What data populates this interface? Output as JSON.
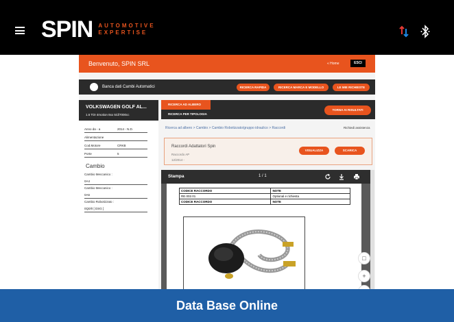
{
  "topbar": {
    "logo_main": "SPIN",
    "logo_sub_1": "AUTOMOTIVE",
    "logo_sub_2": "EXPERTISE",
    "icons": [
      "menu-icon",
      "sort-arrows-icon",
      "bluetooth-icon"
    ],
    "colors": {
      "background": "#000000",
      "logo_accent": "#e8541e",
      "sort_up": "#e53935",
      "sort_down": "#1e88e5"
    }
  },
  "app": {
    "welcome": "Benvenuto, SPIN SRL",
    "home": "« Home",
    "exit": "ESCI",
    "nav_title": "Banca dati Cambi Automatici",
    "nav_buttons": [
      "RICERCA RAPIDA",
      "RICERCA MARCA E MODELLO",
      "LE MIE RICHIESTE"
    ],
    "vehicle": {
      "name": "VOLKSWAGEN GOLF AL...",
      "engine": "1.6 TDI 4motion 8xx 5/d/7000cc"
    },
    "specs": [
      {
        "label": "Anno da - a",
        "value": "2014 - N.D."
      },
      {
        "label": "Alimentazione",
        "value": ""
      },
      {
        "label": "Cod.Motore",
        "value": "CRKB"
      },
      {
        "label": "Porte",
        "value": "5"
      }
    ],
    "gearbox_heading": "Cambio",
    "gearbox": [
      {
        "label": "Cambio Meccanico :",
        "value": "0A4"
      },
      {
        "label": "Cambio Meccanico :",
        "value": "0A6"
      },
      {
        "label": "Cambio Robotizzato :",
        "value": "0Q0/0 [ DSG ]"
      }
    ],
    "tabs": [
      "RICERCA AD ALBERO",
      "RICERCA PER TIPOLOGIA"
    ],
    "back_button": "TORNA AI RISULTATI",
    "breadcrumb": "Ricerca ad albero  >  Cambio  >  Cambio Robotizzato/gruppo idraulico  >  Raccordi",
    "assistance": "Richiedi assistenza",
    "card": {
      "title": "Raccordi Adattatori Spin",
      "line1": "Raccordo AP",
      "line2": "12/2014 -",
      "buttons": [
        "VISUALIZZA",
        "SCARICA"
      ]
    },
    "viewer": {
      "title": "Stampa",
      "page": "1 / 1",
      "icons": [
        "refresh-icon",
        "download-icon",
        "print-icon"
      ]
    },
    "doc_table": [
      {
        "col1": "CODICE RACCORDO",
        "col2": "NOTE",
        "header": true
      },
      {
        "col1": "RE.002.01",
        "col2": "Optional e richiesta",
        "header": false
      },
      {
        "col1": "CODICE RACCORDO",
        "col2": "NOTE",
        "header": true
      }
    ],
    "zoom_controls": [
      "□",
      "+",
      "−"
    ],
    "colors": {
      "accent": "#e8541e",
      "dark": "#2b2b2b"
    }
  },
  "footer": {
    "label": "Data Base Online",
    "color": "#1f5fa6"
  }
}
